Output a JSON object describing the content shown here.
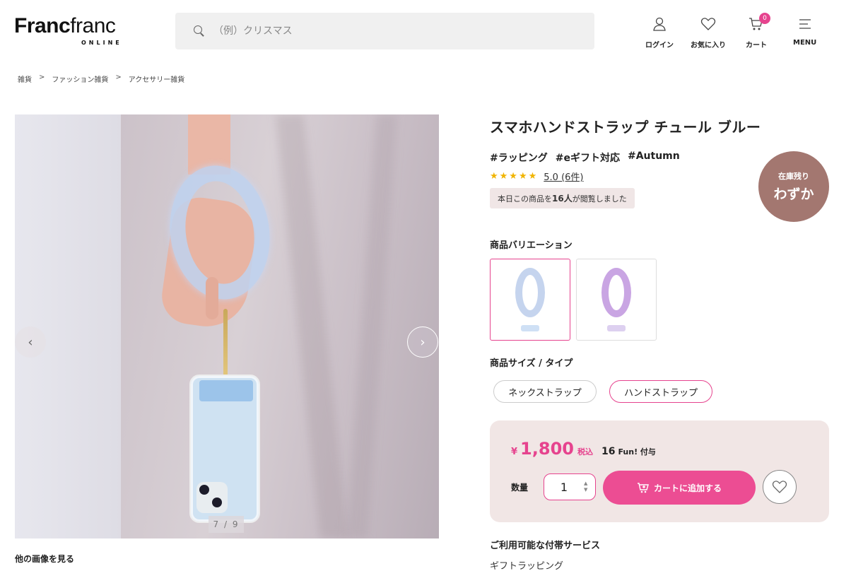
{
  "header": {
    "logo_bold": "Franc",
    "logo_light": "franc",
    "logo_sub": "ONLINE",
    "search_placeholder": "（例）クリスマス",
    "nav": [
      {
        "label": "ログイン",
        "icon": "user-icon"
      },
      {
        "label": "お気に入り",
        "icon": "heart-icon"
      },
      {
        "label": "カート",
        "icon": "cart-icon",
        "badge": "0"
      },
      {
        "label": "MENU",
        "icon": "menu-icon"
      }
    ]
  },
  "breadcrumb": [
    "雑貨",
    "ファッション雑貨",
    "アクセサリー雑貨"
  ],
  "breadcrumb_sep": ">",
  "gallery": {
    "counter": "7 / 9",
    "prev_icon": "‹",
    "next_icon": "›",
    "more_images": "他の画像を見る"
  },
  "product": {
    "title": "スマホハンドストラップ チュール ブルー",
    "tags": [
      "#ラッピング",
      "#eギフト対応",
      "#Autumn"
    ],
    "stars": "★★★★★",
    "rating_text": "5.0 (6件)",
    "viewed_prefix": "本日この商品を",
    "viewed_count": "16人",
    "viewed_suffix": "が閲覧しました",
    "stock_line1": "在庫残り",
    "stock_line2": "わずか"
  },
  "variation": {
    "label": "商品バリエーション",
    "items": [
      {
        "name": "blue",
        "color": "#c5d4ee",
        "clip": "#cfe0f5",
        "selected": true
      },
      {
        "name": "purple",
        "color": "#c9a5e3",
        "clip": "#ddd0f0",
        "selected": false
      }
    ]
  },
  "size_type": {
    "label": "商品サイズ / タイプ",
    "options": [
      "ネックストラップ",
      "ハンドストラップ"
    ],
    "selected_index": 1
  },
  "purchase": {
    "yen": "¥",
    "price": "1,800",
    "tax": "税込",
    "fun_points": "16",
    "fun_suffix": "Fun! 付与",
    "qty_label": "数量",
    "qty_value": "1",
    "add_to_cart": "カートに追加する"
  },
  "services": {
    "title": "ご利用可能な付帯サービス",
    "item": "ギフトラッピング"
  },
  "colors": {
    "accent": "#e6438e",
    "stock_badge": "#a37770",
    "buy_box_bg": "#f1e6e5"
  }
}
